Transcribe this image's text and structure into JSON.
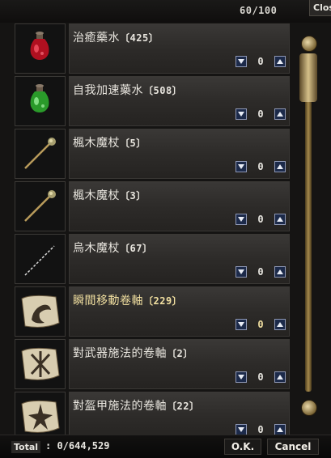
{
  "window": {
    "capacity": "60/100",
    "close_label": "Close"
  },
  "items": [
    {
      "name": "治癒藥水",
      "count": "〔425〕",
      "qty": "0",
      "icon": "red-potion-icon"
    },
    {
      "name": "自我加速藥水",
      "count": "〔508〕",
      "qty": "0",
      "icon": "green-potion-icon"
    },
    {
      "name": "楓木魔杖",
      "count": "〔5〕",
      "qty": "0",
      "icon": "maple-wand-icon"
    },
    {
      "name": "楓木魔杖",
      "count": "〔3〕",
      "qty": "0",
      "icon": "maple-wand-icon"
    },
    {
      "name": "烏木魔杖",
      "count": "〔67〕",
      "qty": "0",
      "icon": "ebony-wand-icon"
    },
    {
      "name": "瞬間移動卷軸",
      "count": "〔229〕",
      "qty": "0",
      "icon": "teleport-scroll-icon"
    },
    {
      "name": "對武器施法的卷軸",
      "count": "〔2〕",
      "qty": "0",
      "icon": "enchant-weapon-scroll-icon"
    },
    {
      "name": "對盔甲施法的卷軸",
      "count": "〔22〕",
      "qty": "0",
      "icon": "enchant-armor-scroll-icon"
    }
  ],
  "footer": {
    "total_label": "Total",
    "total_value": ": 0/644,529",
    "ok_label": "O.K.",
    "cancel_label": "Cancel"
  },
  "colors": {
    "selected_text": "#f1dfa0",
    "stepper_fill": "#1c2a4a"
  }
}
